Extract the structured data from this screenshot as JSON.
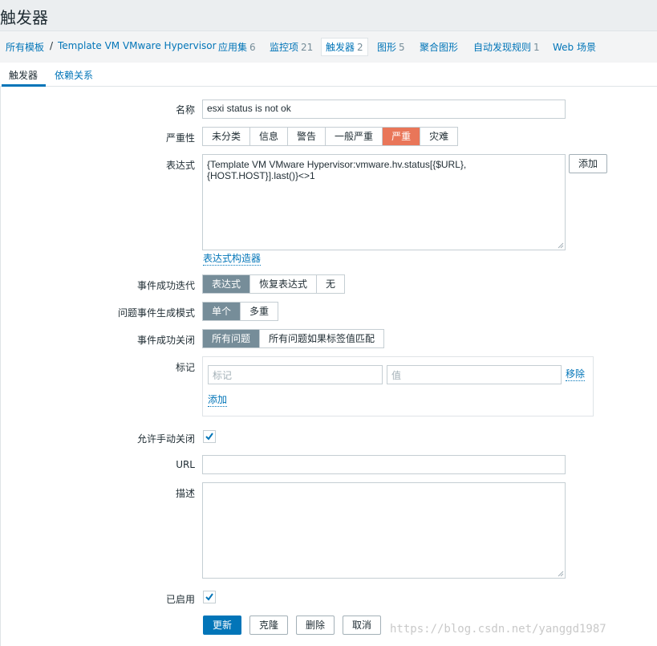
{
  "page_title": "触发器",
  "host_nav": {
    "all_templates": "所有模板",
    "separator": "/",
    "template_name": "Template VM VMware Hypervisor",
    "applications": {
      "label": "应用集",
      "count": "6"
    },
    "items": {
      "label": "监控项",
      "count": "21"
    },
    "triggers": {
      "label": "触发器",
      "count": "2"
    },
    "graphs": {
      "label": "图形",
      "count": "5"
    },
    "screens": {
      "label": "聚合图形"
    },
    "discovery": {
      "label": "自动发现规则",
      "count": "1"
    },
    "web": {
      "label": "Web 场景"
    }
  },
  "tabs": [
    {
      "label": "触发器",
      "active": true
    },
    {
      "label": "依赖关系",
      "active": false
    }
  ],
  "form": {
    "name_label": "名称",
    "name_value": "esxi status is not ok",
    "severity_label": "严重性",
    "severity_options": [
      "未分类",
      "信息",
      "警告",
      "一般严重",
      "严重",
      "灾难"
    ],
    "severity_selected": "严重",
    "expression_label": "表达式",
    "expression_line1": "{Template VM VMware Hypervisor:vmware.hv.status[{$URL},",
    "expression_line2": "{HOST.HOST}].last()}<>1",
    "add_button": "添加",
    "constructor_link": "表达式构造器",
    "ok_event_gen_label": "事件成功迭代",
    "ok_event_gen_options": [
      "表达式",
      "恢复表达式",
      "无"
    ],
    "ok_event_gen_selected": "表达式",
    "problem_mode_label": "问题事件生成模式",
    "problem_mode_options": [
      "单个",
      "多重"
    ],
    "problem_mode_selected": "单个",
    "ok_close_label": "事件成功关闭",
    "ok_close_options": [
      "所有问题",
      "所有问题如果标签值匹配"
    ],
    "ok_close_selected": "所有问题",
    "tags_label": "标记",
    "tag_placeholder": "标记",
    "value_placeholder": "值",
    "remove_link": "移除",
    "add_tag_link": "添加",
    "manual_close_label": "允许手动关闭",
    "manual_close_checked": true,
    "url_label": "URL",
    "url_value": "",
    "description_label": "描述",
    "description_value": "",
    "enabled_label": "已启用",
    "enabled_checked": true
  },
  "buttons": {
    "update": "更新",
    "clone": "克隆",
    "delete": "删除",
    "cancel": "取消"
  },
  "watermark": "https://blog.csdn.net/yanggd1987",
  "colors": {
    "accent": "#0275b8",
    "severity_high": "#e97659",
    "selected_segment": "#768d99"
  }
}
